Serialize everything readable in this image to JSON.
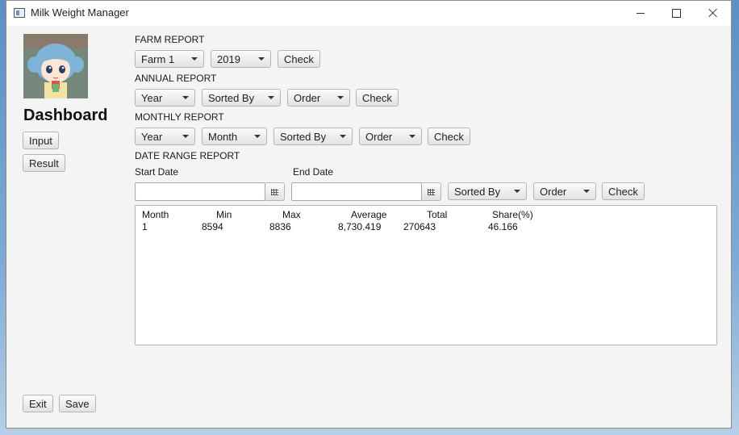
{
  "window": {
    "title": "Milk Weight Manager"
  },
  "sidebar": {
    "heading": "Dashboard",
    "input_label": "Input",
    "result_label": "Result",
    "exit_label": "Exit",
    "save_label": "Save"
  },
  "farm_report": {
    "heading": "FARM REPORT",
    "farm_value": "Farm 1",
    "year_value": "2019",
    "check_label": "Check"
  },
  "annual_report": {
    "heading": "ANNUAL REPORT",
    "year_value": "Year",
    "sorted_by_value": "Sorted By",
    "order_value": "Order",
    "check_label": "Check"
  },
  "monthly_report": {
    "heading": "MONTHLY REPORT",
    "year_value": "Year",
    "month_value": "Month",
    "sorted_by_value": "Sorted By",
    "order_value": "Order",
    "check_label": "Check"
  },
  "date_range_report": {
    "heading": "DATE RANGE REPORT",
    "start_date_label": "Start Date",
    "end_date_label": "End Date",
    "start_date_value": "",
    "end_date_value": "",
    "sorted_by_value": "Sorted By",
    "order_value": "Order",
    "check_label": "Check"
  },
  "results": {
    "columns": [
      "Month",
      "Min",
      "Max",
      "Average",
      "Total",
      "Share(%)"
    ],
    "rows": [
      [
        "1",
        "8594",
        "8836",
        "8,730.419",
        "270643",
        "46.166"
      ]
    ]
  },
  "icons": {
    "app": "app-window-icon",
    "calendar": "calendar-icon",
    "dropdown": "chevron-down-icon"
  },
  "colors": {
    "window_bg": "#f4f4f4",
    "button_border": "#b4b4b4",
    "desktop": "#6f9acb"
  }
}
